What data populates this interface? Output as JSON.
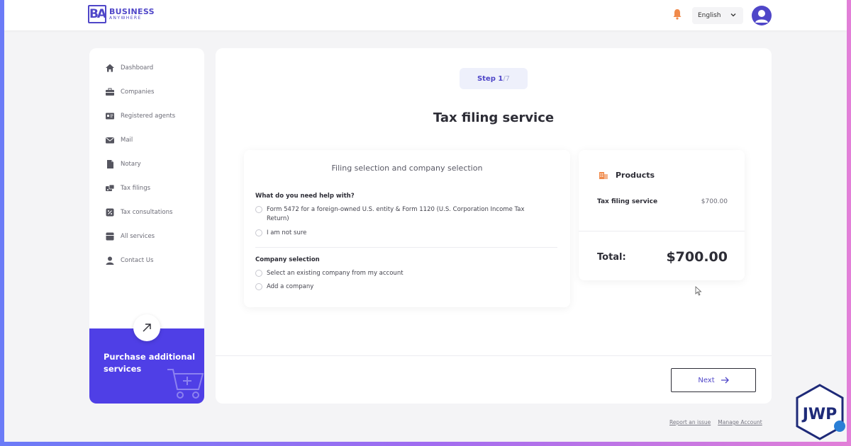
{
  "brand": {
    "line1": "BUSINESS",
    "line2": "ANYWHERE",
    "mark": "BA"
  },
  "header": {
    "language": "English"
  },
  "sidebar": {
    "items": [
      {
        "label": "Dashboard",
        "icon": "home-icon"
      },
      {
        "label": "Companies",
        "icon": "briefcase-icon"
      },
      {
        "label": "Registered agents",
        "icon": "id-card-icon"
      },
      {
        "label": "Mail",
        "icon": "mail-icon"
      },
      {
        "label": "Notary",
        "icon": "document-icon"
      },
      {
        "label": "Tax filings",
        "icon": "tax-icon"
      },
      {
        "label": "Tax consultations",
        "icon": "percent-icon"
      },
      {
        "label": "All services",
        "icon": "box-icon"
      },
      {
        "label": "Contact Us",
        "icon": "person-icon"
      }
    ],
    "promo": {
      "title": "Purchase additional services"
    }
  },
  "main": {
    "step": {
      "label": "Step 1",
      "of": "/7"
    },
    "title": "Tax filing service",
    "form": {
      "heading": "Filing selection and company selection",
      "question": "What do you need help with?",
      "options": [
        "Form 5472 for a foreign-owned U.S. entity & Form 1120 (U.S. Corporation Income Tax Return)",
        "I am not sure"
      ],
      "company_heading": "Company selection",
      "company_options": [
        "Select an existing company from my account",
        "Add a company"
      ]
    },
    "products": {
      "heading": "Products",
      "item_name": "Tax filing service",
      "item_price": "$700.00",
      "total_label": "Total:",
      "total_value": "$700.00"
    },
    "next_label": "Next"
  },
  "footer": {
    "report": "Report an issue",
    "manage": "Manage Account"
  },
  "colors": {
    "primary": "#4f46c8",
    "promo": "#4f3fe6",
    "bell": "#f08a4b"
  }
}
